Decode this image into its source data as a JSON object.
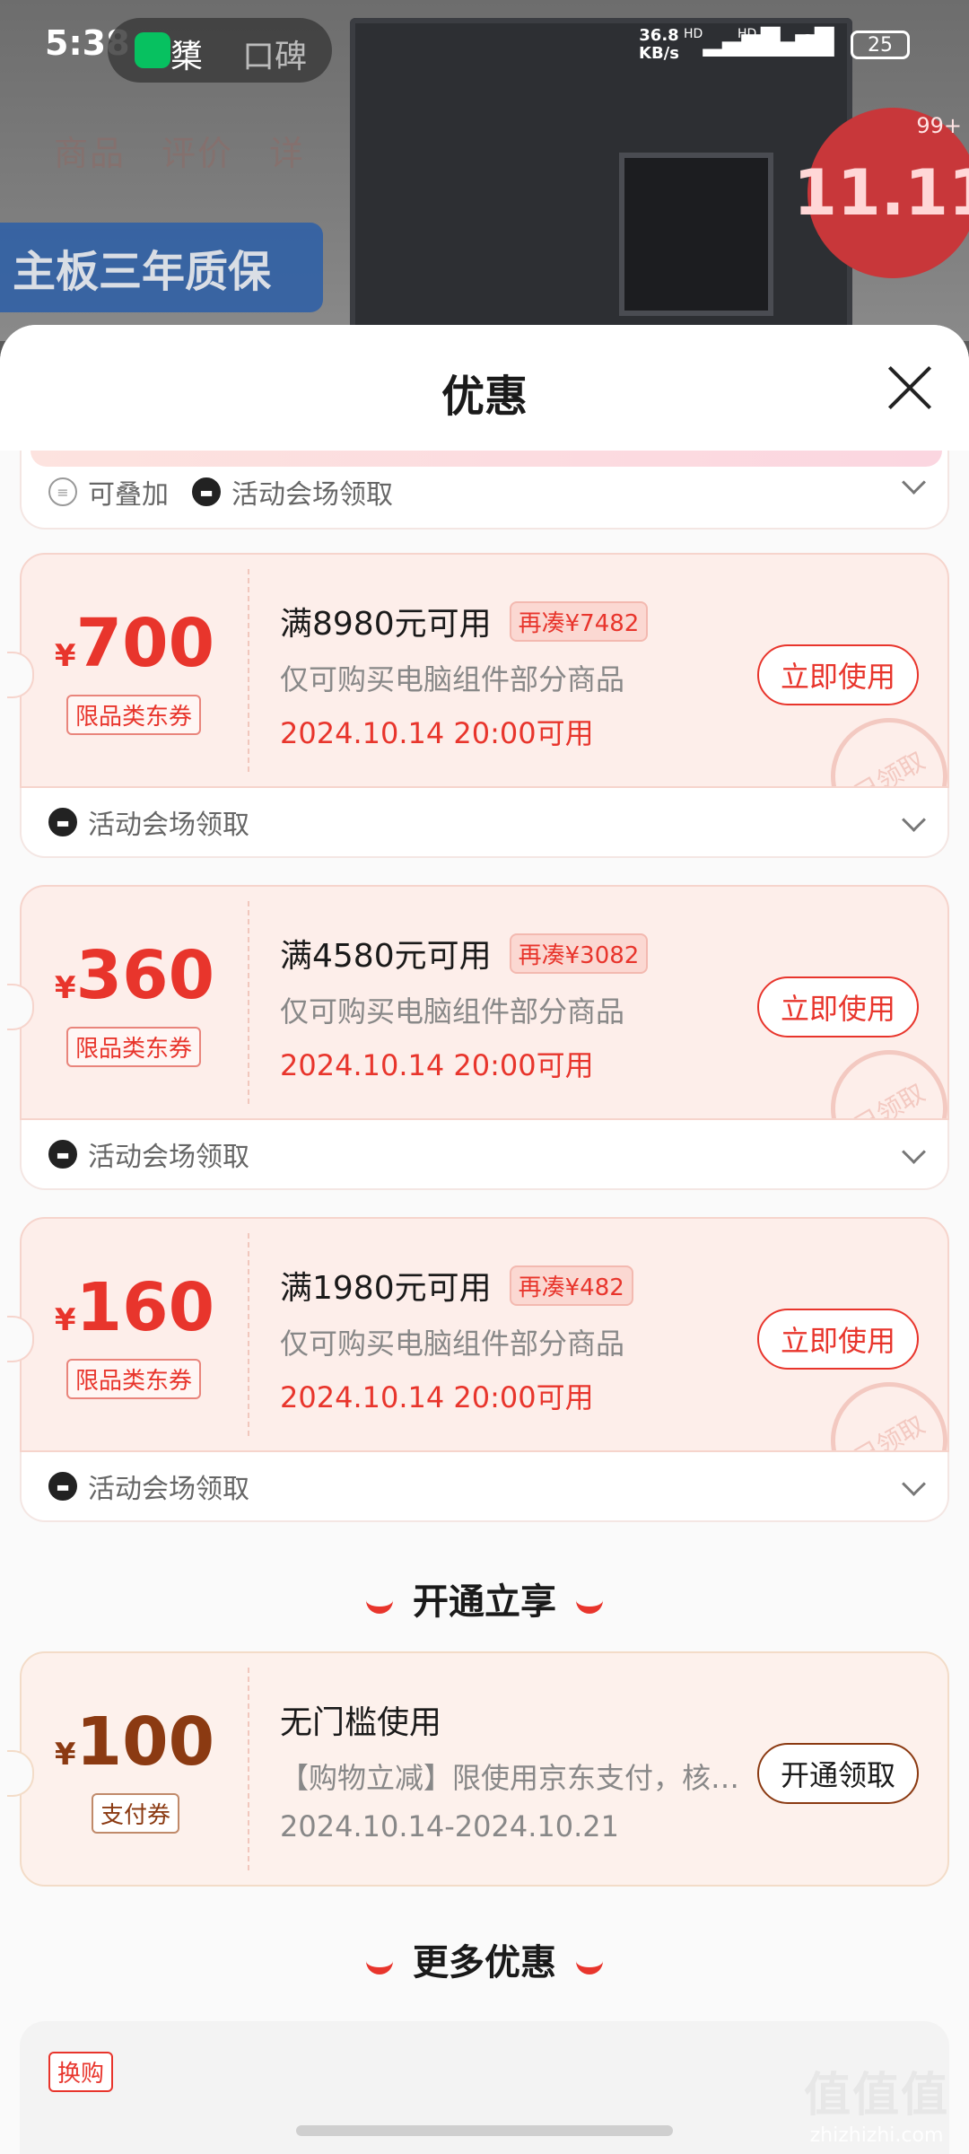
{
  "status_bar": {
    "time": "5:38",
    "app_label": "橥",
    "app2_label": "口碑",
    "net_speed_value": "36.8",
    "net_speed_unit": "KB/s",
    "sig1": "HD",
    "sig2": "HD",
    "battery": "25"
  },
  "background": {
    "nav_tabs": [
      "商品",
      "评价",
      "详"
    ],
    "warranty_banner": "主板三年质保",
    "promo_badge": "11.11",
    "promo_badge_count": "99+"
  },
  "sheet": {
    "title": "优惠"
  },
  "partial_card": {
    "tag_stack": "可叠加",
    "tag_venue": "活动会场领取"
  },
  "coupons": [
    {
      "yen": "¥",
      "amount": "700",
      "type": "限品类东券",
      "condition": "满8980元可用",
      "add_more": "再凑¥7482",
      "desc": "仅可购买电脑组件部分商品",
      "date": "2024.10.14 20:00可用",
      "button": "立即使用",
      "stamp": "已领取",
      "footer": "活动会场领取"
    },
    {
      "yen": "¥",
      "amount": "360",
      "type": "限品类东券",
      "condition": "满4580元可用",
      "add_more": "再凑¥3082",
      "desc": "仅可购买电脑组件部分商品",
      "date": "2024.10.14 20:00可用",
      "button": "立即使用",
      "stamp": "已领取",
      "footer": "活动会场领取"
    },
    {
      "yen": "¥",
      "amount": "160",
      "type": "限品类东券",
      "condition": "满1980元可用",
      "add_more": "再凑¥482",
      "desc": "仅可购买电脑组件部分商品",
      "date": "2024.10.14 20:00可用",
      "button": "立即使用",
      "stamp": "已领取",
      "footer": "活动会场领取"
    }
  ],
  "section_open": {
    "title": "开通立享"
  },
  "pay_coupon": {
    "yen": "¥",
    "amount": "100",
    "type": "支付券",
    "condition": "无门槛使用",
    "desc": "【购物立减】限使用京东支付，核…",
    "date": "2024.10.14-2024.10.21",
    "button": "开通领取"
  },
  "section_more": {
    "title": "更多优惠"
  },
  "more_card": {
    "tag": "换购"
  },
  "watermark": {
    "logo": "值值值",
    "site": "zhizhizhi.com"
  },
  "colors": {
    "accent_red": "#e8352c",
    "coupon_bg": "#fdeeea",
    "brown": "#8b3a12"
  }
}
